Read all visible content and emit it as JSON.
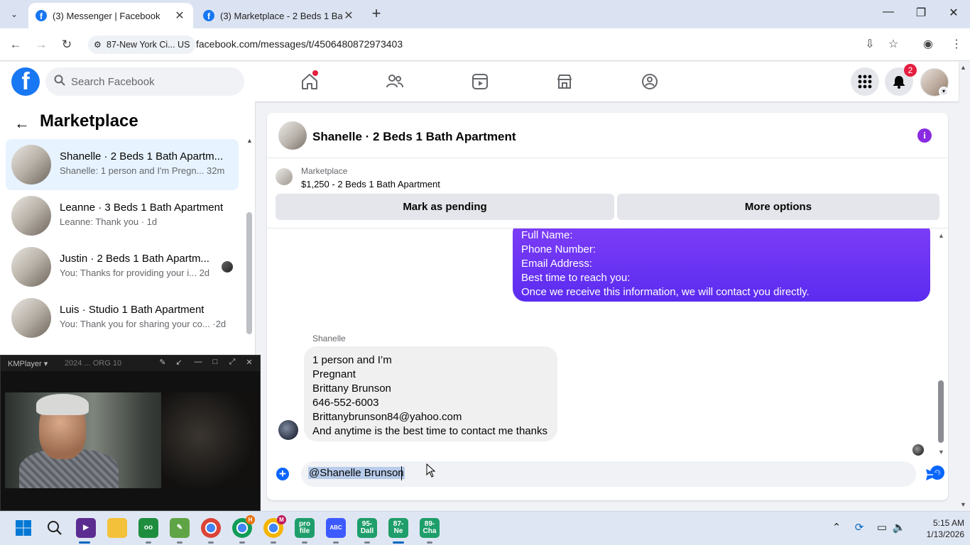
{
  "browser": {
    "tabs": [
      {
        "title": "(3) Messenger | Facebook",
        "active": true
      },
      {
        "title": "(3) Marketplace - 2 Beds 1 Bath",
        "active": false
      }
    ],
    "site_chip": "87-New York Ci... US",
    "url": "facebook.com/messages/t/4506480872973403"
  },
  "fb_header": {
    "logo": "f",
    "search_placeholder": "Search Facebook",
    "notification_count": "2",
    "icons": [
      "home-icon",
      "friends-icon",
      "video-icon",
      "marketplace-icon",
      "groups-icon",
      "menu-grid-icon",
      "bell-icon"
    ]
  },
  "sidebar": {
    "title": "Marketplace",
    "conversations": [
      {
        "name": "Shanelle · 2 Beds 1 Bath Apartm...",
        "preview": "Shanelle: 1 person and I'm Pregn...",
        "time": "32m",
        "selected": true
      },
      {
        "name": "Leanne · 3 Beds 1 Bath Apartment",
        "preview": "Leanne: Thank you",
        "time": "1d",
        "selected": false
      },
      {
        "name": "Justin · 2 Beds 1 Bath Apartm...",
        "preview": "You: Thanks for providing your i...",
        "time": "2d",
        "selected": false
      },
      {
        "name": "Luis · Studio 1 Bath Apartment",
        "preview": "You: Thank you for sharing your co...",
        "time": "2d",
        "selected": false
      }
    ]
  },
  "kmplayer": {
    "app_name": "KMPlayer",
    "title_text": "2024 ... ORG 10"
  },
  "chat": {
    "title": "Shanelle · 2 Beds 1 Bath Apartment",
    "listing_label": "Marketplace",
    "listing_detail": "$1,250 - 2 Beds 1 Bath Apartment",
    "mark_pending_label": "Mark as pending",
    "more_options_label": "More options",
    "outgoing_lines": [
      "Full Name:",
      "Phone Number:",
      "Email Address:",
      "Best time to reach you:",
      "Once we receive this information, we will contact you directly."
    ],
    "sender_name": "Shanelle",
    "incoming_lines": [
      "1 person and I’m",
      "Pregnant",
      "Brittany Brunson",
      "646-552-6003",
      "Brittanybrunson84@yahoo.com",
      "And anytime is the best time to contact me thanks"
    ],
    "composer_text": "@Shanelle Brunson"
  },
  "taskbar": {
    "apps": [
      {
        "label": "",
        "icon": "windows-start-icon"
      },
      {
        "label": "",
        "icon": "search-icon"
      },
      {
        "label": "",
        "icon": "visual-studio-icon"
      },
      {
        "label": "",
        "icon": "file-explorer-icon"
      },
      {
        "label": "",
        "icon": "app-icon"
      },
      {
        "label": "",
        "icon": "notepad-icon"
      },
      {
        "label": "",
        "icon": "chrome-icon"
      },
      {
        "label": "H",
        "icon": "chrome-profile-h-icon"
      },
      {
        "label": "M",
        "icon": "chrome-profile-m-icon"
      },
      {
        "label": "pro file",
        "icon": "profile-app-icon"
      },
      {
        "label": "ABC",
        "icon": "abc-app-icon"
      },
      {
        "label": "95- Dall",
        "icon": "dall-app-icon"
      },
      {
        "label": "87- Ne",
        "icon": "ne-app-icon"
      },
      {
        "label": "89- Cha",
        "icon": "cha-app-icon"
      }
    ],
    "time": "5:15 AM",
    "date": "1/13/2026"
  },
  "colors": {
    "fb_blue": "#1877f2",
    "messenger_purple": "#6a2bf5",
    "selected_row": "#e7f3ff",
    "notification_red": "#e41e3f"
  }
}
